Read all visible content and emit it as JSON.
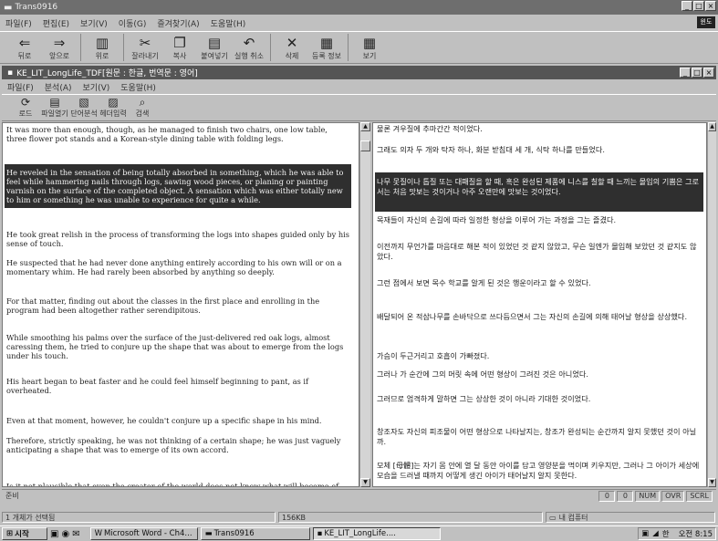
{
  "outer": {
    "title": "Trans0916",
    "menu": [
      "파일(F)",
      "편집(E)",
      "보기(V)",
      "이동(G)",
      "즐겨찾기(A)",
      "도움말(H)"
    ],
    "toolbar": [
      {
        "icon": "back-arrow-icon",
        "glyph": "⇐",
        "label": "뒤로"
      },
      {
        "icon": "forward-arrow-icon",
        "glyph": "⇒",
        "label": "앞으로"
      },
      {
        "icon": "up-folder-icon",
        "glyph": "▥",
        "label": "위로"
      },
      {
        "icon": "scissors-icon",
        "glyph": "✂",
        "label": "잘라내기"
      },
      {
        "icon": "copy-icon",
        "glyph": "❐",
        "label": "복사"
      },
      {
        "icon": "paste-icon",
        "glyph": "▤",
        "label": "붙여넣기"
      },
      {
        "icon": "undo-icon",
        "glyph": "↶",
        "label": "실행 취소"
      },
      {
        "icon": "delete-x-icon",
        "glyph": "✕",
        "label": "삭제"
      },
      {
        "icon": "properties-icon",
        "glyph": "▦",
        "label": "등록 정보"
      },
      {
        "icon": "view-grid-icon",
        "glyph": "▦",
        "label": "보기"
      }
    ],
    "corner_label": "윈도"
  },
  "inner": {
    "title": "KE_LIT_LongLife_TDF[원문 : 한글, 번역문 : 영어]",
    "menu": [
      "파일(F)",
      "분석(A)",
      "보기(V)",
      "도움말(H)"
    ],
    "toolbar": [
      {
        "icon": "reload-icon",
        "glyph": "⟳",
        "label": "로드"
      },
      {
        "icon": "open-file-icon",
        "glyph": "▤",
        "label": "파일열기"
      },
      {
        "icon": "word-analysis-icon",
        "glyph": "▧",
        "label": "단어분석"
      },
      {
        "icon": "header-input-icon",
        "glyph": "▨",
        "label": "헤더입력"
      },
      {
        "icon": "search-icon",
        "glyph": "⌕",
        "label": "검색"
      }
    ]
  },
  "left_paragraphs": [
    {
      "text": "It was more than enough, though, as he managed to finish two chairs, one low table, three flower pot stands and a Korean-style dining table with folding legs.",
      "hl": false
    },
    {
      "text": "He reveled in the sensation of being totally absorbed in something, which he was able to feel while hammering nails through logs, sawing wood pieces, or planing or painting varnish on the surface of the completed object. A sensation which was either totally new to him or something he was unable to experience for quite a while.",
      "hl": true
    },
    {
      "text": "He took great relish in the process of transforming the logs into shapes guided only by his sense of touch.",
      "hl": false
    },
    {
      "text": "He suspected that he had never done anything entirely according to his own will or on a momentary whim. He had rarely been absorbed by anything so deeply.",
      "hl": false
    },
    {
      "text": "For that matter, finding out about the classes in the first place and enrolling in the program had been altogether rather serendipitous.",
      "hl": false
    },
    {
      "text": "While smoothing his palms over the surface of the just-delivered red oak logs, almost caressing them, he tried to conjure up the shape that was about to emerge from the logs under his touch.",
      "hl": false
    },
    {
      "text": "His heart began to beat faster and he could feel himself beginning to pant, as if overheated.",
      "hl": false
    },
    {
      "text": "Even at that moment, however, he couldn't conjure up a specific shape in his mind.",
      "hl": false
    },
    {
      "text": "Therefore, strictly speaking, he was not thinking of a certain shape; he was just vaguely anticipating a shape that was to emerge of its own accord.",
      "hl": false
    },
    {
      "text": "Is it not plausible that even the creator of the world does not know what will become of his",
      "hl": false
    }
  ],
  "right_paragraphs": [
    {
      "text": "물론 겨우질에 추마간간 적이었다.",
      "hl": false
    },
    {
      "text": "그래도 의자 두 개와 탁자 하나, 화분 받침대 세 개, 식탁 하나를 만들었다.",
      "hl": false
    },
    {
      "text": "나무 못질이나 톱질 또는 대패질을 할 때, 혹은 완성된 제품에 니스를 칠할 때 느끼는 몰입의 기쁨은 그로서는 처음 맛보는 것이거나 아주 오랜만에 맛보는 것이었다.",
      "hl": true
    },
    {
      "text": "목재들이 자신의 손길에 따라 일정한 형상을 이루어 가는 과정을 그는 즐겼다.",
      "hl": false
    },
    {
      "text": "이전까지 무언가를 마음대로 해본 적이 있었던 것 같지 않았고, 무슨 일엔가 몰입해 보았던 것 같지도 않았다.",
      "hl": false
    },
    {
      "text": "그런 점에서 보면 목수 학교를 알게 된 것은 행운이라고 할 수 있었다.",
      "hl": false
    },
    {
      "text": "배달되어 온 적삼나무를 손바닥으로 쓰다듬으면서 그는 자신의 손길에 의해 태어날 형상을 상상했다.",
      "hl": false
    },
    {
      "text": "가슴이 두근거리고 호흡이 가빠졌다.",
      "hl": false
    },
    {
      "text": "그러나 가 순간에 그의 머릿 속에 어떤 형상이 그려진 것은 아니었다.",
      "hl": false
    },
    {
      "text": "그러므로 엄격하게 말하면 그는 상상한 것이 아니라 기대한 것이었다.",
      "hl": false
    },
    {
      "text": "창조자도 자신의 피조물이 어떤 형상으로 나타날지는, 창조가 완성되는 순간까지 알지 못했던 것이 아닐까.",
      "hl": false
    },
    {
      "text": "모체 [母體]는 자기 몸 안에 열 달 동안 아이를 담고 영양분을 먹이며 키우지만, 그러나 그 아이가 세상에 모습을 드러낼 때까지 어떻게 생긴 아이가 태어날지 알지 못한다.",
      "hl": false
    }
  ],
  "inner_status": {
    "left": "준비",
    "boxes": [
      "0",
      "0",
      "NUM",
      "OVR",
      "SCRL"
    ]
  },
  "outer_status": {
    "selected": "1 개체가 선택됨",
    "size": "156KB",
    "location": "내 컴퓨터"
  },
  "taskbar": {
    "start": "시작",
    "tasks": [
      "Microsoft Word - Ch4...",
      "Trans0916",
      "KE_LIT_LongLife...."
    ],
    "clock": "오전 8:15"
  }
}
